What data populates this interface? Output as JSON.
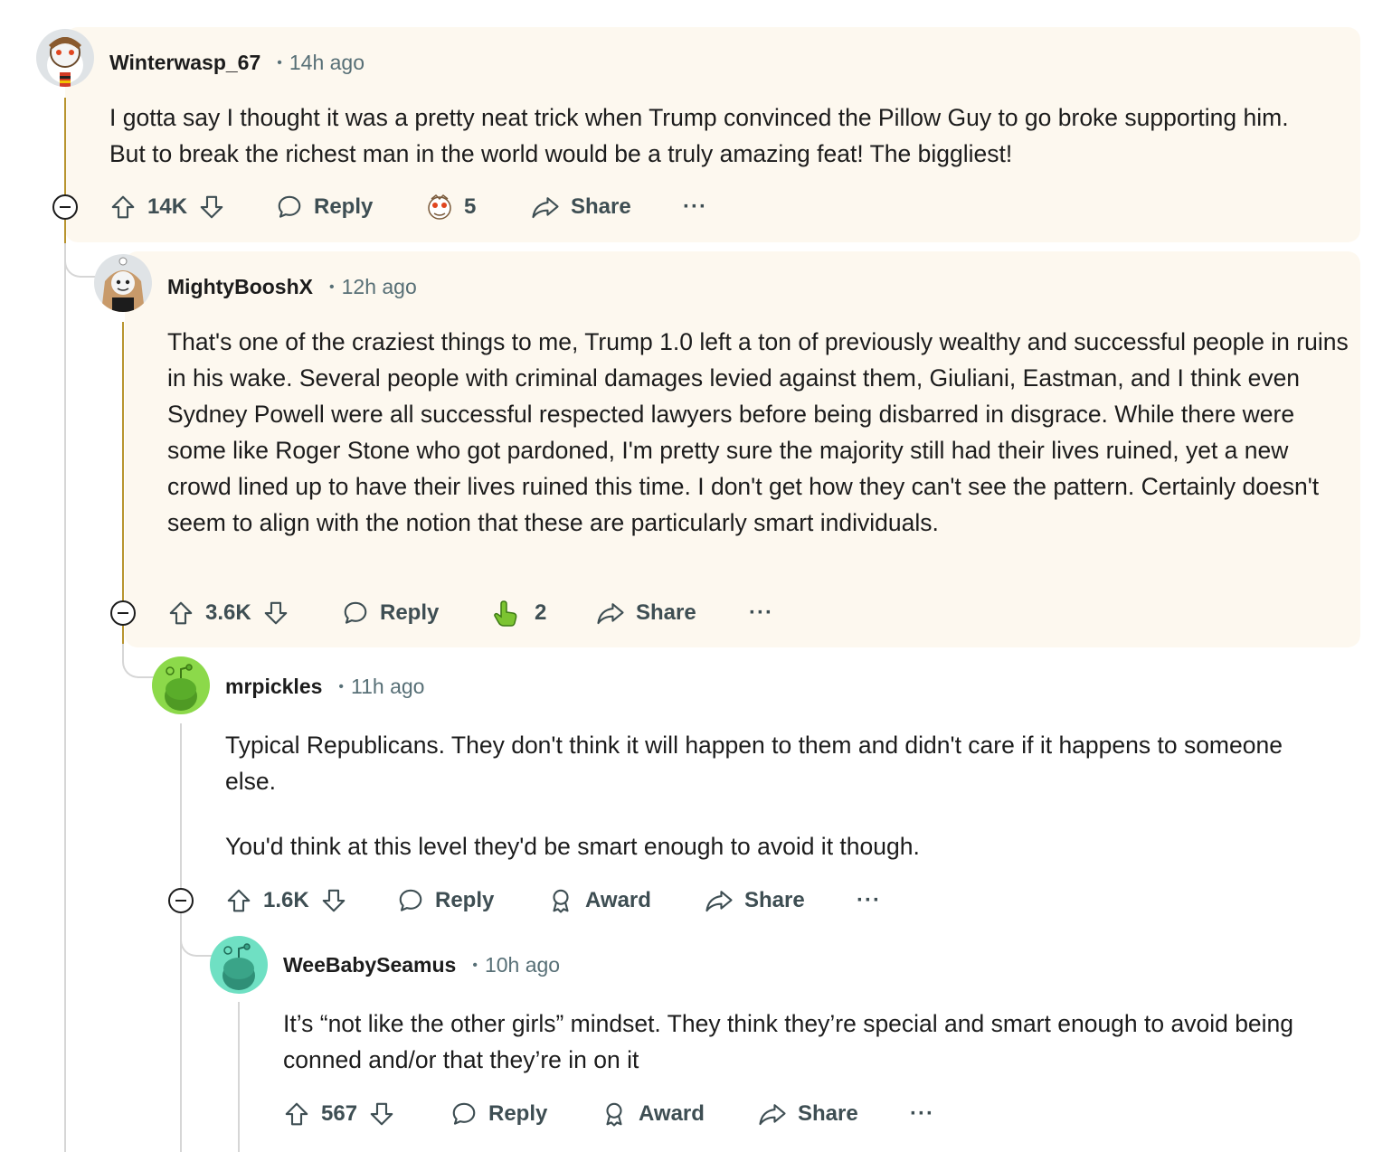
{
  "comments": [
    {
      "username": "Winterwasp_67",
      "separator": "•",
      "time": "14h ago",
      "body": [
        "I gotta say I thought it was a pretty neat trick when Trump convinced the Pillow Guy to go broke supporting him. But to break the richest man in the world would be a truly amazing feat! The biggliest!"
      ],
      "votes": "14K",
      "reply_label": "Reply",
      "award_count": "5",
      "share_label": "Share",
      "more_label": "···"
    },
    {
      "username": "MightyBooshX",
      "separator": "•",
      "time": "12h ago",
      "body": [
        "That's one of the craziest things to me, Trump 1.0 left a ton of previously wealthy and successful people in ruins in his wake. Several people with criminal damages levied against them, Giuliani, Eastman, and I think even Sydney Powell were all successful respected lawyers before being disbarred in disgrace. While there were some like Roger Stone who got pardoned, I'm pretty sure the majority still had their lives ruined, yet a new crowd lined up to have their lives ruined this time. I don't get how they can't see the pattern. Certainly doesn't seem to align with the notion that these are particularly smart individuals."
      ],
      "votes": "3.6K",
      "reply_label": "Reply",
      "award_count": "2",
      "share_label": "Share",
      "more_label": "···"
    },
    {
      "username": "mrpickles",
      "separator": "•",
      "time": "11h ago",
      "body": [
        "Typical Republicans.  They don't think it will happen to them and didn't care if it happens to someone else.",
        "You'd think at this level they'd be smart enough to avoid it though."
      ],
      "votes": "1.6K",
      "reply_label": "Reply",
      "award_label": "Award",
      "share_label": "Share",
      "more_label": "···"
    },
    {
      "username": "WeeBabySeamus",
      "separator": "•",
      "time": "10h ago",
      "body": [
        "It’s “not like the other girls” mindset. They think they’re special and smart enough to avoid being conned and/or that they’re in on it"
      ],
      "votes": "567",
      "reply_label": "Reply",
      "award_label": "Award",
      "share_label": "Share",
      "more_label": "···"
    }
  ],
  "colors": {
    "highlight_bg": "#fdf8ef",
    "thread_gold": "#b8942e",
    "thread_grey": "#d6d6d6",
    "meta_grey": "#576f76",
    "action_text": "#3e4e53"
  },
  "icons": {
    "upvote": "arrow-up-outline-icon",
    "downvote": "arrow-down-outline-icon",
    "reply": "speech-bubble-icon",
    "award": "award-ribbon-icon",
    "share": "share-arrow-icon",
    "collapse": "minus-circle-icon"
  }
}
